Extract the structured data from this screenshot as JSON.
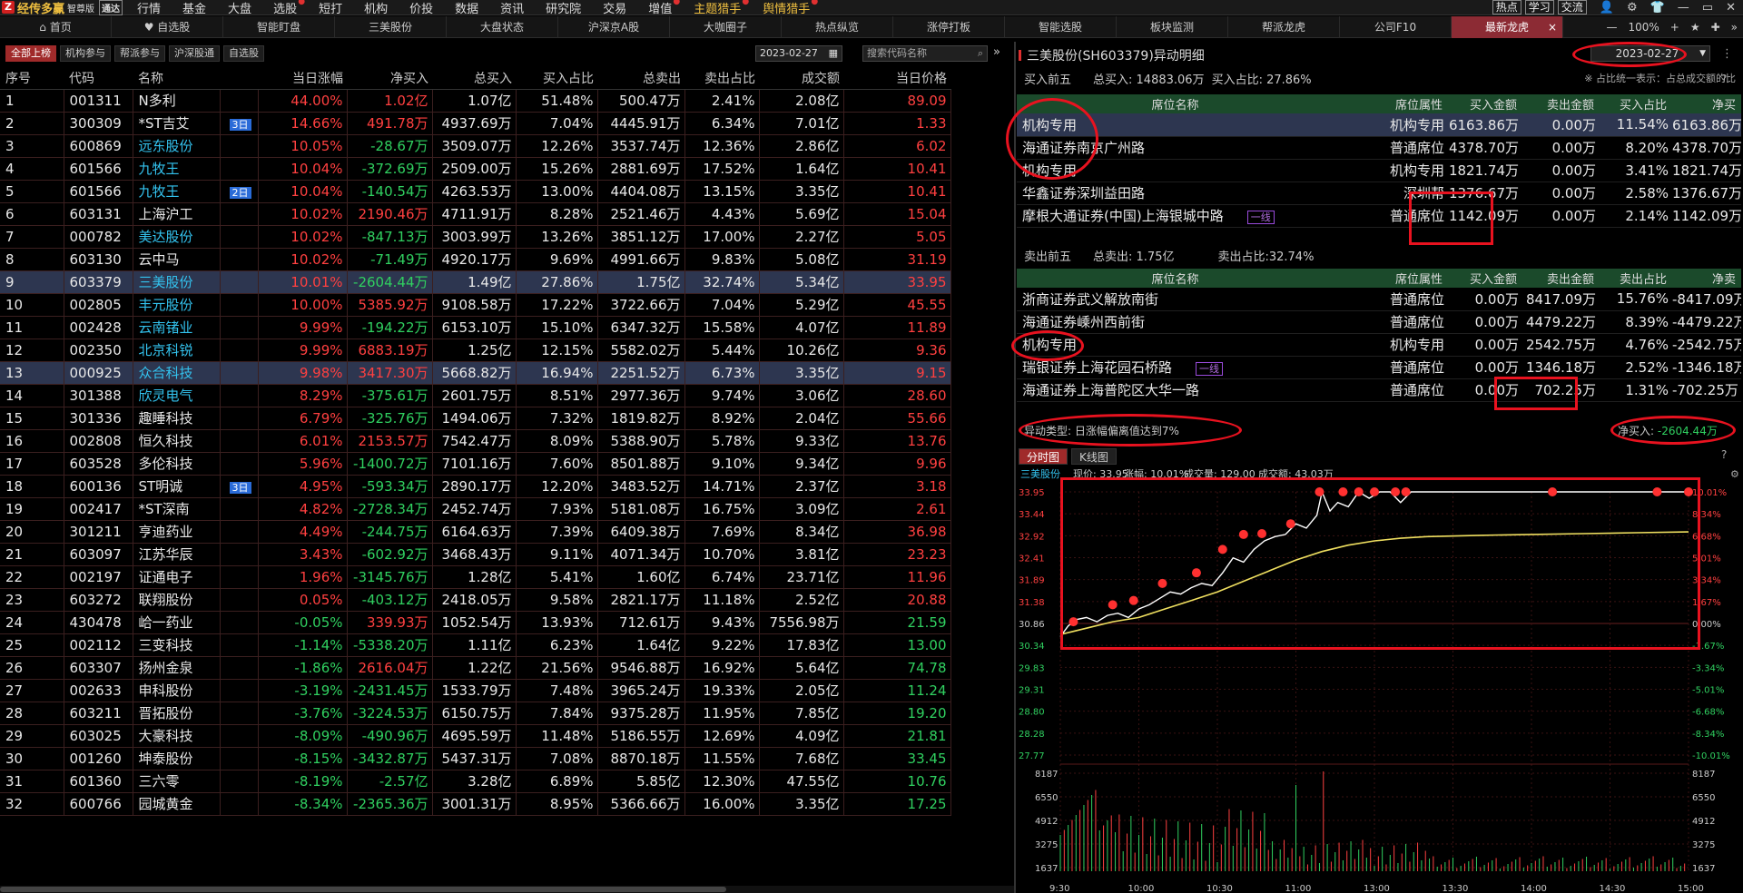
{
  "menubar": {
    "logo_text": "经传多赢",
    "edition": "智尊版",
    "edition2": "通达",
    "items": [
      {
        "label": "行情",
        "hl": false,
        "dot": false
      },
      {
        "label": "基金",
        "hl": false,
        "dot": false
      },
      {
        "label": "大盘",
        "hl": false,
        "dot": false
      },
      {
        "label": "选股",
        "hl": false,
        "dot": true
      },
      {
        "label": "短打",
        "hl": false,
        "dot": false
      },
      {
        "label": "机构",
        "hl": false,
        "dot": false
      },
      {
        "label": "价投",
        "hl": false,
        "dot": false
      },
      {
        "label": "数据",
        "hl": false,
        "dot": false
      },
      {
        "label": "资讯",
        "hl": false,
        "dot": false
      },
      {
        "label": "研究院",
        "hl": false,
        "dot": false
      },
      {
        "label": "交易",
        "hl": false,
        "dot": false
      },
      {
        "label": "增值",
        "hl": false,
        "dot": true
      },
      {
        "label": "主题猎手",
        "hl": true,
        "dot": true
      },
      {
        "label": "舆情猎手",
        "hl": true,
        "dot": true
      }
    ],
    "right_buttons": [
      "热点",
      "学习",
      "交流"
    ]
  },
  "tabs": [
    {
      "label": "首页",
      "icon": "home"
    },
    {
      "label": "自选股",
      "icon": "heart"
    },
    {
      "label": "智能盯盘"
    },
    {
      "label": "三美股份"
    },
    {
      "label": "大盘状态"
    },
    {
      "label": "沪深京A股"
    },
    {
      "label": "大咖圈子"
    },
    {
      "label": "热点纵览"
    },
    {
      "label": "涨停打板"
    },
    {
      "label": "智能选股"
    },
    {
      "label": "板块监测"
    },
    {
      "label": "帮派龙虎"
    },
    {
      "label": "公司F10"
    },
    {
      "label": "最新龙虎",
      "active": true
    }
  ],
  "tab_tools": {
    "zoom": "100%"
  },
  "left": {
    "filters": [
      {
        "label": "全部上榜",
        "on": true
      },
      {
        "label": "机构参与",
        "on": false
      },
      {
        "label": "帮派参与",
        "on": false
      },
      {
        "label": "沪深股通",
        "on": false
      },
      {
        "label": "自选股",
        "on": false
      }
    ],
    "date": "2023-02-27",
    "search_placeholder": "搜索代码名称",
    "columns": [
      "序号",
      "代码",
      "名称",
      "",
      "当日涨幅",
      "净买入",
      "总买入",
      "买入占比",
      "总卖出",
      "卖出占比",
      "成交额",
      "当日价格"
    ],
    "rows": [
      [
        "1",
        "001311",
        "N多利",
        "",
        "44.00%",
        "1.02亿",
        "1.07亿",
        "51.48%",
        "500.47万",
        "2.41%",
        "2.08亿",
        "89.09"
      ],
      [
        "2",
        "300309",
        "*ST吉艾",
        "3日",
        "14.66%",
        "491.78万",
        "4937.69万",
        "7.04%",
        "4445.91万",
        "6.34%",
        "7.01亿",
        "1.33"
      ],
      [
        "3",
        "600869",
        "远东股份",
        "",
        "10.05%",
        "-28.67万",
        "3509.07万",
        "12.26%",
        "3537.74万",
        "12.36%",
        "2.86亿",
        "6.02"
      ],
      [
        "4",
        "601566",
        "九牧王",
        "",
        "10.04%",
        "-372.69万",
        "2509.00万",
        "15.26%",
        "2881.69万",
        "17.52%",
        "1.64亿",
        "10.41"
      ],
      [
        "5",
        "601566",
        "九牧王",
        "2日",
        "10.04%",
        "-140.54万",
        "4263.53万",
        "13.00%",
        "4404.08万",
        "13.15%",
        "3.35亿",
        "10.41"
      ],
      [
        "6",
        "603131",
        "上海沪工",
        "",
        "10.02%",
        "2190.46万",
        "4711.91万",
        "8.28%",
        "2521.46万",
        "4.43%",
        "5.69亿",
        "15.04"
      ],
      [
        "7",
        "000782",
        "美达股份",
        "",
        "10.02%",
        "-847.13万",
        "3003.99万",
        "13.26%",
        "3851.12万",
        "17.00%",
        "2.27亿",
        "5.05"
      ],
      [
        "8",
        "603130",
        "云中马",
        "",
        "10.02%",
        "-71.49万",
        "4920.17万",
        "9.69%",
        "4991.66万",
        "9.83%",
        "5.08亿",
        "31.19"
      ],
      [
        "9",
        "603379",
        "三美股份",
        "",
        "10.01%",
        "-2604.44万",
        "1.49亿",
        "27.86%",
        "1.75亿",
        "32.74%",
        "5.34亿",
        "33.95"
      ],
      [
        "10",
        "002805",
        "丰元股份",
        "",
        "10.00%",
        "5385.92万",
        "9108.58万",
        "17.22%",
        "3722.66万",
        "7.04%",
        "5.29亿",
        "45.55"
      ],
      [
        "11",
        "002428",
        "云南锗业",
        "",
        "9.99%",
        "-194.22万",
        "6153.10万",
        "15.10%",
        "6347.32万",
        "15.58%",
        "4.07亿",
        "11.89"
      ],
      [
        "12",
        "002350",
        "北京科锐",
        "",
        "9.99%",
        "6883.19万",
        "1.25亿",
        "12.15%",
        "5582.02万",
        "5.44%",
        "10.26亿",
        "9.36"
      ],
      [
        "13",
        "000925",
        "众合科技",
        "",
        "9.98%",
        "3417.30万",
        "5668.82万",
        "16.94%",
        "2251.52万",
        "6.73%",
        "3.35亿",
        "9.15"
      ],
      [
        "14",
        "301388",
        "欣灵电气",
        "",
        "8.29%",
        "-375.61万",
        "2601.75万",
        "8.51%",
        "2977.36万",
        "9.74%",
        "3.06亿",
        "28.60"
      ],
      [
        "15",
        "301336",
        "趣睡科技",
        "",
        "6.79%",
        "-325.76万",
        "1494.06万",
        "7.32%",
        "1819.82万",
        "8.92%",
        "2.04亿",
        "55.66"
      ],
      [
        "16",
        "002808",
        "恒久科技",
        "",
        "6.01%",
        "2153.57万",
        "7542.47万",
        "8.09%",
        "5388.90万",
        "5.78%",
        "9.33亿",
        "13.76"
      ],
      [
        "17",
        "603528",
        "多伦科技",
        "",
        "5.96%",
        "-1400.72万",
        "7101.16万",
        "7.60%",
        "8501.88万",
        "9.10%",
        "9.34亿",
        "9.96"
      ],
      [
        "18",
        "600136",
        "ST明诚",
        "3日",
        "4.95%",
        "-593.34万",
        "2890.17万",
        "12.20%",
        "3483.52万",
        "14.71%",
        "2.37亿",
        "3.18"
      ],
      [
        "19",
        "002417",
        "*ST深南",
        "",
        "4.82%",
        "-2728.34万",
        "2452.74万",
        "7.93%",
        "5181.08万",
        "16.75%",
        "3.09亿",
        "2.61"
      ],
      [
        "20",
        "301211",
        "亨迪药业",
        "",
        "4.49%",
        "-244.75万",
        "6164.63万",
        "7.39%",
        "6409.38万",
        "7.69%",
        "8.34亿",
        "36.98"
      ],
      [
        "21",
        "603097",
        "江苏华辰",
        "",
        "3.43%",
        "-602.92万",
        "3468.43万",
        "9.11%",
        "4071.34万",
        "10.70%",
        "3.81亿",
        "23.23"
      ],
      [
        "22",
        "002197",
        "证通电子",
        "",
        "1.96%",
        "-3145.76万",
        "1.28亿",
        "5.41%",
        "1.60亿",
        "6.74%",
        "23.71亿",
        "11.96"
      ],
      [
        "23",
        "603272",
        "联翔股份",
        "",
        "0.05%",
        "-403.12万",
        "2418.05万",
        "9.58%",
        "2821.17万",
        "11.18%",
        "2.52亿",
        "20.88"
      ],
      [
        "24",
        "430478",
        "峆一药业",
        "",
        "-0.05%",
        "339.93万",
        "1052.54万",
        "13.93%",
        "712.61万",
        "9.43%",
        "7556.98万",
        "21.59"
      ],
      [
        "25",
        "002112",
        "三变科技",
        "",
        "-1.14%",
        "-5338.20万",
        "1.11亿",
        "6.23%",
        "1.64亿",
        "9.22%",
        "17.83亿",
        "13.00"
      ],
      [
        "26",
        "603307",
        "扬州金泉",
        "",
        "-1.86%",
        "2616.04万",
        "1.22亿",
        "21.56%",
        "9546.88万",
        "16.92%",
        "5.64亿",
        "74.78"
      ],
      [
        "27",
        "002633",
        "申科股份",
        "",
        "-3.19%",
        "-2431.45万",
        "1533.79万",
        "7.48%",
        "3965.24万",
        "19.33%",
        "2.05亿",
        "11.24"
      ],
      [
        "28",
        "603211",
        "晋拓股份",
        "",
        "-3.76%",
        "-3224.53万",
        "6150.75万",
        "7.84%",
        "9375.28万",
        "11.95%",
        "7.85亿",
        "19.20"
      ],
      [
        "29",
        "603025",
        "大豪科技",
        "",
        "-8.09%",
        "-490.96万",
        "4695.59万",
        "11.48%",
        "5186.55万",
        "12.69%",
        "4.09亿",
        "21.81"
      ],
      [
        "30",
        "001260",
        "坤泰股份",
        "",
        "-8.15%",
        "-3432.87万",
        "5437.31万",
        "7.08%",
        "8870.18万",
        "11.55%",
        "7.68亿",
        "33.45"
      ],
      [
        "31",
        "601360",
        "三六零",
        "",
        "-8.19%",
        "-2.57亿",
        "3.28亿",
        "6.89%",
        "5.85亿",
        "12.30%",
        "47.55亿",
        "10.76"
      ],
      [
        "32",
        "600766",
        "园城黄金",
        "",
        "-8.34%",
        "-2365.36万",
        "3001.31万",
        "8.95%",
        "5366.66万",
        "16.00%",
        "3.35亿",
        "17.25"
      ]
    ]
  },
  "right": {
    "title": "三美股份(SH603379)异动明细",
    "date": "2023-02-27",
    "buy_summary": {
      "label": "买入前五",
      "total": "总买入: 14883.06万",
      "ratio": "买入占比: 27.86%",
      "note": "※ 占比统一表示：占总成交额的比"
    },
    "columns": [
      "席位名称",
      "席位属性",
      "买入金额",
      "卖出金额",
      "买入占比",
      "净买"
    ],
    "sell_columns": [
      "席位名称",
      "席位属性",
      "买入金额",
      "卖出金额",
      "卖出占比",
      "净卖"
    ],
    "buy_rows": [
      [
        "机构专用",
        "",
        "机构专用",
        "6163.86万",
        "0.00万",
        "11.54%",
        "6163.86万"
      ],
      [
        "海通证券南京广州路",
        "",
        "普通席位",
        "4378.70万",
        "0.00万",
        "8.20%",
        "4378.70万"
      ],
      [
        "机构专用",
        "",
        "机构专用",
        "1821.74万",
        "0.00万",
        "3.41%",
        "1821.74万"
      ],
      [
        "华鑫证券深圳益田路",
        "",
        "深圳帮",
        "1376.67万",
        "0.00万",
        "2.58%",
        "1376.67万"
      ],
      [
        "摩根大通证券(中国)上海银城中路",
        "一线",
        "普通席位",
        "1142.09万",
        "0.00万",
        "2.14%",
        "1142.09万"
      ]
    ],
    "sell_summary": {
      "label": "卖出前五",
      "total": "总卖出: 1.75亿",
      "ratio": "卖出占比:32.74%"
    },
    "sell_rows": [
      [
        "浙商证券武义解放南街",
        "",
        "普通席位",
        "0.00万",
        "8417.09万",
        "15.76%",
        "-8417.09万"
      ],
      [
        "海通证券嵊州西前街",
        "",
        "普通席位",
        "0.00万",
        "4479.22万",
        "8.39%",
        "-4479.22万"
      ],
      [
        "机构专用",
        "",
        "机构专用",
        "0.00万",
        "2542.75万",
        "4.76%",
        "-2542.75万"
      ],
      [
        "瑞银证券上海花园石桥路",
        "一线",
        "普通席位",
        "0.00万",
        "1346.18万",
        "2.52%",
        "-1346.18万"
      ],
      [
        "海通证券上海普陀区大华一路",
        "",
        "普通席位",
        "0.00万",
        "702.25万",
        "1.31%",
        "-702.25万"
      ]
    ],
    "anomaly": "异动类型: 日涨幅偏离值达到7%",
    "net_buy_label": "净买入:",
    "net_buy_value": "-2604.44万",
    "chart_tabs": [
      "分时图",
      "K线图"
    ],
    "chart_header": {
      "name": "三美股份",
      "price": "现价: 33.95",
      "pct": "涨幅: 10.01%",
      "vol": "成交量: 129.00",
      "amt": "成交额: 43.03万"
    }
  },
  "chart_data": {
    "type": "line",
    "title": "",
    "x_labels": [
      "9:30",
      "10:00",
      "10:30",
      "11:00",
      "13:00",
      "13:30",
      "14:00",
      "14:30",
      "15:00"
    ],
    "y_left": [
      "33.95",
      "33.44",
      "32.92",
      "32.41",
      "31.89",
      "31.38",
      "30.86",
      "30.34",
      "29.83",
      "29.31",
      "28.80",
      "28.28",
      "27.77"
    ],
    "y_right": [
      "10.01%",
      "8.34%",
      "6.68%",
      "5.01%",
      "3.34%",
      "1.67%",
      "0.00%",
      "-1.67%",
      "-3.34%",
      "-5.01%",
      "-6.68%",
      "-8.34%",
      "-10.01%"
    ],
    "vol_ticks": [
      "8187",
      "6550",
      "4912",
      "3275",
      "1637"
    ],
    "prev_close": 30.86,
    "ylim": [
      27.77,
      33.95
    ],
    "series": [
      {
        "color": "#ffffff",
        "values": [
          [
            0,
            30.55
          ],
          [
            3,
            30.8
          ],
          [
            6,
            30.95
          ],
          [
            10,
            31.0
          ],
          [
            14,
            30.9
          ],
          [
            18,
            31.05
          ],
          [
            22,
            31.1
          ],
          [
            26,
            31.0
          ],
          [
            30,
            31.2
          ],
          [
            34,
            31.3
          ],
          [
            38,
            31.45
          ],
          [
            42,
            31.6
          ],
          [
            46,
            31.55
          ],
          [
            50,
            31.7
          ],
          [
            54,
            31.8
          ],
          [
            58,
            31.75
          ],
          [
            62,
            32.05
          ],
          [
            66,
            32.4
          ],
          [
            70,
            32.3
          ],
          [
            74,
            32.6
          ],
          [
            78,
            32.8
          ],
          [
            82,
            32.9
          ],
          [
            86,
            32.95
          ],
          [
            90,
            33.2
          ],
          [
            94,
            33.1
          ],
          [
            98,
            33.4
          ],
          [
            100,
            33.95
          ],
          [
            103,
            33.5
          ],
          [
            106,
            33.7
          ],
          [
            110,
            33.6
          ],
          [
            114,
            33.95
          ],
          [
            118,
            33.8
          ],
          [
            122,
            33.95
          ],
          [
            126,
            33.95
          ],
          [
            130,
            33.7
          ],
          [
            134,
            33.95
          ],
          [
            240,
            33.95
          ]
        ]
      },
      {
        "color": "#f0e060",
        "values": [
          [
            0,
            30.6
          ],
          [
            10,
            30.75
          ],
          [
            20,
            30.9
          ],
          [
            30,
            31.0
          ],
          [
            40,
            31.2
          ],
          [
            50,
            31.4
          ],
          [
            60,
            31.6
          ],
          [
            70,
            31.85
          ],
          [
            80,
            32.1
          ],
          [
            90,
            32.35
          ],
          [
            100,
            32.55
          ],
          [
            110,
            32.7
          ],
          [
            120,
            32.8
          ],
          [
            130,
            32.86
          ],
          [
            140,
            32.9
          ],
          [
            160,
            32.93
          ],
          [
            180,
            32.95
          ],
          [
            200,
            32.97
          ],
          [
            220,
            32.99
          ],
          [
            240,
            33.01
          ]
        ]
      }
    ],
    "markers": [
      [
        5,
        30.9
      ],
      [
        20,
        31.3
      ],
      [
        28,
        31.4
      ],
      [
        39,
        31.8
      ],
      [
        52,
        32.05
      ],
      [
        62,
        32.6
      ],
      [
        70,
        32.95
      ],
      [
        77,
        32.97
      ],
      [
        88,
        33.2
      ],
      [
        99,
        33.95
      ],
      [
        108,
        33.95
      ],
      [
        114,
        33.95
      ],
      [
        120,
        33.95
      ],
      [
        128,
        33.95
      ],
      [
        132,
        33.95
      ],
      [
        188,
        33.95
      ],
      [
        228,
        33.95
      ],
      [
        252,
        33.95
      ]
    ]
  }
}
